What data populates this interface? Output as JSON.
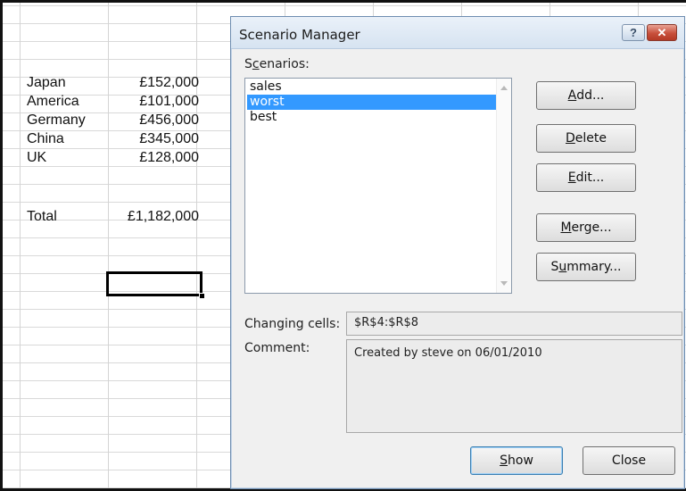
{
  "sheet": {
    "rows": [
      {
        "label": "Japan",
        "value": "£152,000"
      },
      {
        "label": "America",
        "value": "£101,000"
      },
      {
        "label": "Germany",
        "value": "£456,000"
      },
      {
        "label": "China",
        "value": "£345,000"
      },
      {
        "label": "UK",
        "value": "£128,000"
      }
    ],
    "total": {
      "label": "Total",
      "value": "£1,182,000"
    }
  },
  "dialog": {
    "title": "Scenario Manager",
    "help_glyph": "?",
    "close_glyph": "✕",
    "scenarios_label_prefix": "S",
    "scenarios_label_underlined": "c",
    "scenarios_label_rest": "enarios:",
    "scenarios": [
      "sales",
      "worst",
      "best"
    ],
    "selected_scenario": "worst",
    "buttons": {
      "add": {
        "ul": "A",
        "rest": "dd..."
      },
      "delete": {
        "ul": "D",
        "rest": "elete"
      },
      "edit": {
        "ul": "E",
        "rest": "dit..."
      },
      "merge": {
        "pre": "",
        "ul": "M",
        "rest": "erge..."
      },
      "summary": {
        "pre": "S",
        "ul": "u",
        "rest": "mmary..."
      }
    },
    "changing_cells_label": "Changing cells:",
    "changing_cells_value": "$R$4:$R$8",
    "comment_label": "Comment:",
    "comment_value": "Created by steve on 06/01/2010",
    "show_button": {
      "ul": "S",
      "rest": "how"
    },
    "close_button": "Close"
  },
  "colors": {
    "selection": "#3399ff",
    "dialog_bg": "#f0f0f0",
    "close_red": "#c8503c"
  }
}
